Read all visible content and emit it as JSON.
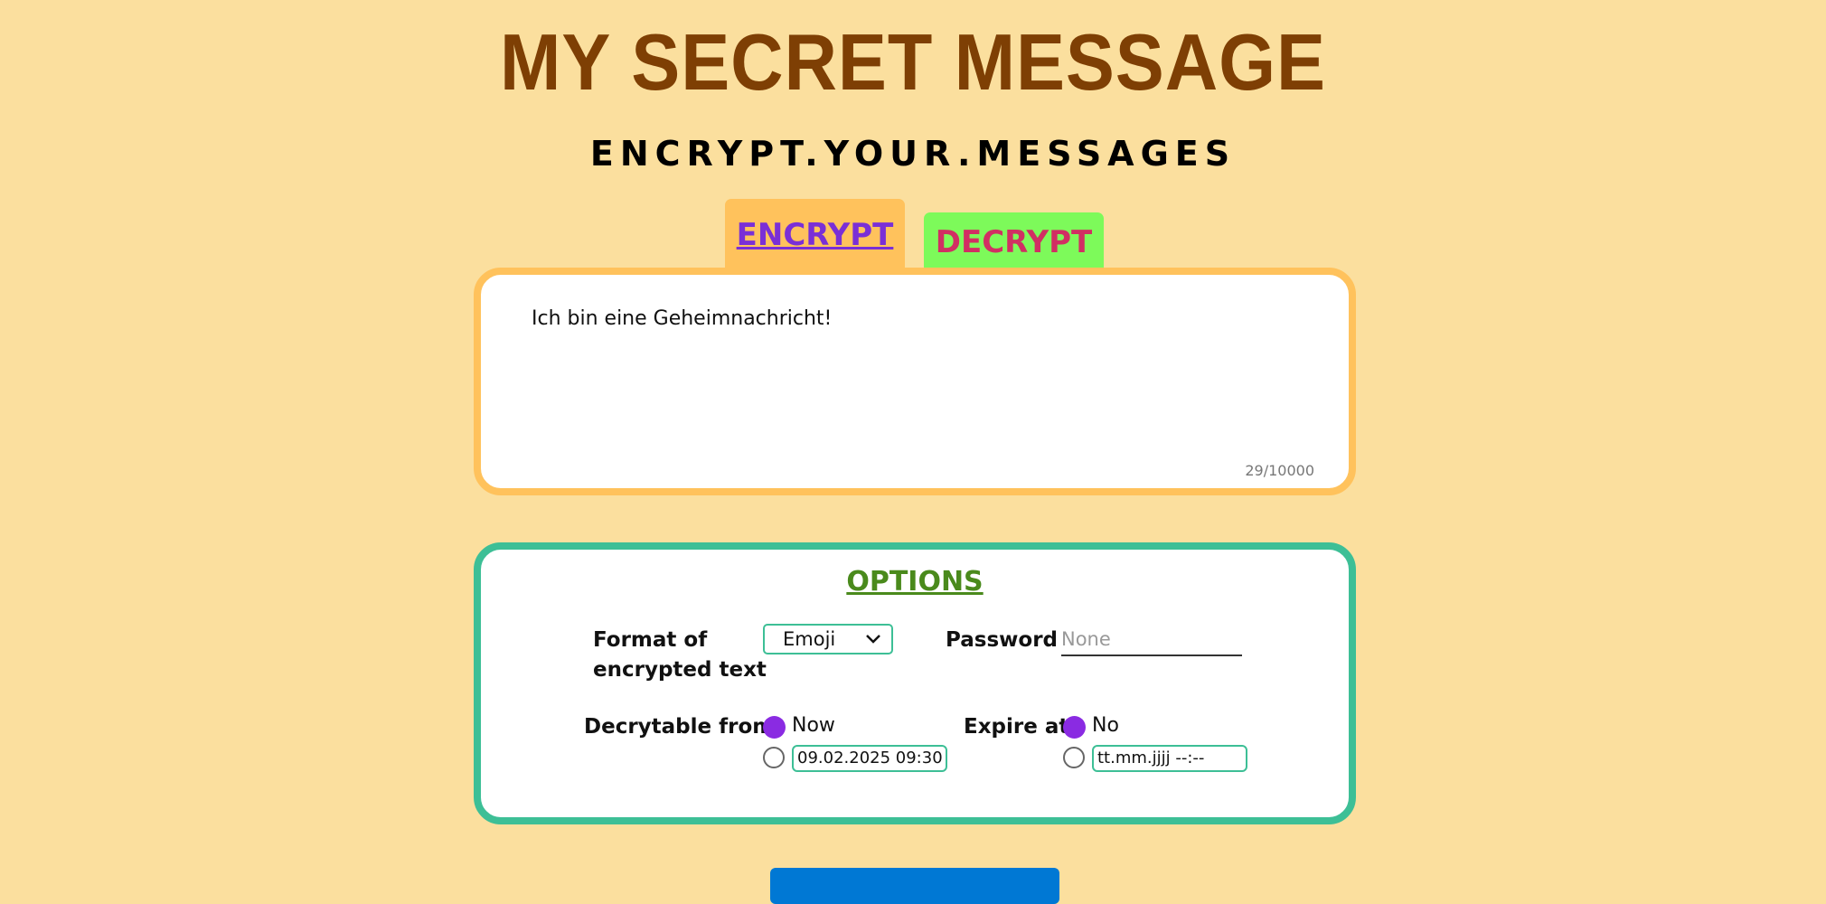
{
  "header": {
    "title": "MY SECRET MESSAGE",
    "subtitle": "ENCRYPT.YOUR.MESSAGES"
  },
  "tabs": {
    "encrypt": "ENCRYPT",
    "decrypt": "DECRYPT"
  },
  "message": {
    "text": "Ich bin eine Geheimnachricht!",
    "count": "29/10000"
  },
  "options": {
    "title": "OPTIONS",
    "format_label_line1": "Format of",
    "format_label_line2": "encrypted text",
    "format_value": "Emoji",
    "password_label": "Password",
    "password_placeholder": "None",
    "decryptable_label": "Decrytable from",
    "decryptable_now": "Now",
    "decryptable_date": "09.02.2025 09:30",
    "expire_label": "Expire at",
    "expire_no": "No",
    "expire_date": "tt.mm.jjjj --:--"
  },
  "colors": {
    "background": "#fbdf9e",
    "title": "#7e3f04",
    "encrypt_tab": "#ffc25c",
    "decrypt_tab": "#7dfa5a",
    "options_border": "#3dbf96",
    "radio_selected": "#8a2be2",
    "submit_button": "#0078d4"
  }
}
